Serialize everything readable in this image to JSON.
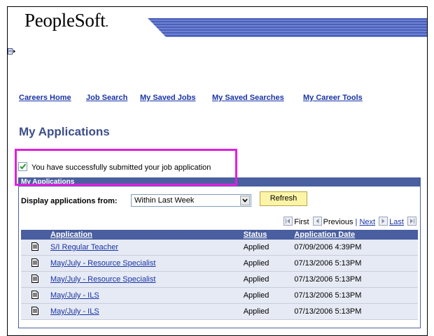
{
  "brand": {
    "logo": "PeopleSoft",
    "logo_mark": "."
  },
  "nav": {
    "items": [
      {
        "label": "Careers Home"
      },
      {
        "label": "Job Search"
      },
      {
        "label": "My Saved Jobs"
      },
      {
        "label": "My Saved Searches"
      },
      {
        "label": "My Career Tools"
      }
    ]
  },
  "page": {
    "title": "My Applications"
  },
  "message": {
    "text": "You have successfully submitted your job application"
  },
  "panel": {
    "header": "My Applications",
    "filter_label": "Display applications from:",
    "filter_value": "Within Last Week",
    "refresh_label": "Refresh"
  },
  "pager": {
    "first": "First",
    "previous": "Previous",
    "separator": "|",
    "next": "Next",
    "last": "Last"
  },
  "table": {
    "headers": {
      "application": "Application",
      "status": "Status",
      "date": "Application Date"
    },
    "rows": [
      {
        "application": "S/I Regular Teacher",
        "status": "Applied",
        "date": "07/09/2006  4:39PM"
      },
      {
        "application": "May/July - Resource Specialist",
        "status": "Applied",
        "date": "07/13/2006  5:13PM"
      },
      {
        "application": "May/July - Resource Specialist",
        "status": "Applied",
        "date": "07/13/2006  5:13PM"
      },
      {
        "application": "May/July - ILS",
        "status": "Applied",
        "date": "07/13/2006  5:13PM"
      },
      {
        "application": "May/July - ILS",
        "status": "Applied",
        "date": "07/13/2006  5:13PM"
      }
    ]
  },
  "colors": {
    "accent": "#4a5fa0",
    "link": "#1933a6",
    "highlight": "#e020e0",
    "button": "#fcf4a8"
  }
}
